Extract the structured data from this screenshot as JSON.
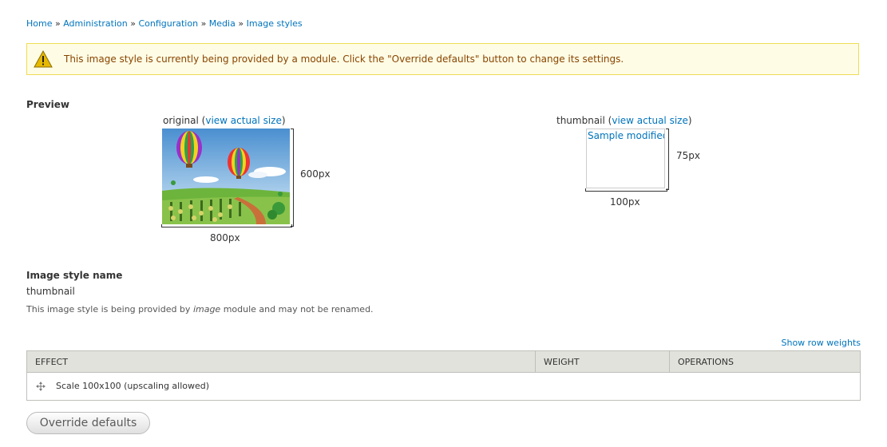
{
  "breadcrumb": {
    "items": [
      "Home",
      "Administration",
      "Configuration",
      "Media",
      "Image styles"
    ],
    "separator": "»"
  },
  "warning": {
    "icon": "warning-icon",
    "message": "This image style is currently being provided by a module. Click the \"Override defaults\" button to change its settings."
  },
  "preview": {
    "heading": "Preview",
    "original": {
      "label": "original",
      "link": "view actual size",
      "height_label": "600px",
      "width_label": "800px"
    },
    "thumbnail": {
      "label": "thumbnail",
      "link": "view actual size",
      "alt": "Sample modified image",
      "height_label": "75px",
      "width_label": "100px"
    }
  },
  "style_name": {
    "heading": "Image style name",
    "value": "thumbnail",
    "desc_before": "This image style is being provided by ",
    "desc_module": "image",
    "desc_after": " module and may not be renamed."
  },
  "table": {
    "show_weights": "Show row weights",
    "columns": [
      "Effect",
      "Weight",
      "Operations"
    ],
    "rows": [
      {
        "effect": "Scale 100x100 (upscaling allowed)",
        "weight": "",
        "operations": ""
      }
    ]
  },
  "override_button": "Override defaults",
  "colors": {
    "link": "#0074bd",
    "warning_bg": "#fffce5",
    "warning_border": "#eedd55",
    "warning_text": "#884400",
    "table_header_bg": "#e1e2dc"
  }
}
